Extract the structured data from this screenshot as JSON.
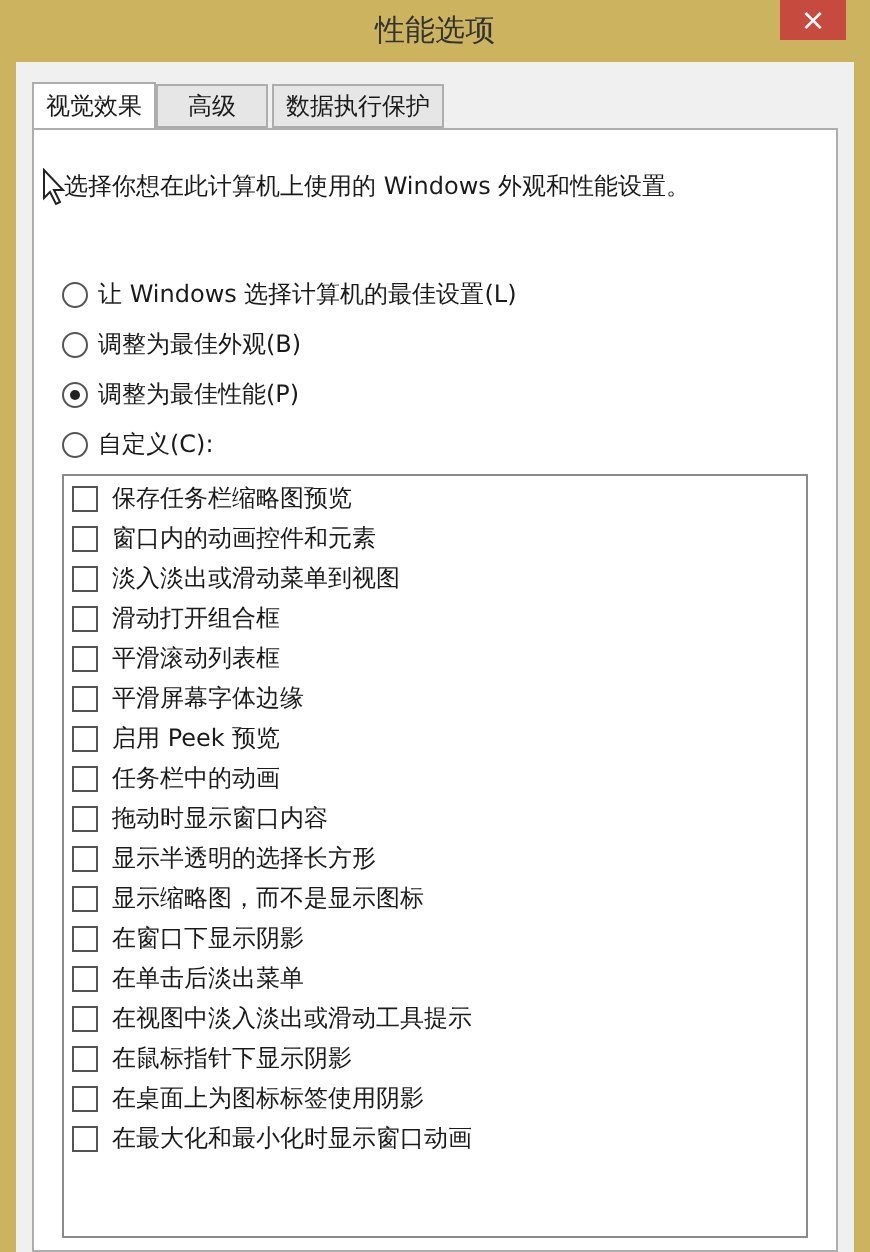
{
  "window": {
    "title": "性能选项",
    "close": "×"
  },
  "tabs": [
    {
      "label": "视觉效果",
      "selected": true
    },
    {
      "label": "高级",
      "selected": false
    },
    {
      "label": "数据执行保护",
      "selected": false
    }
  ],
  "intro": "选择你想在此计算机上使用的 Windows 外观和性能设置。",
  "options": [
    {
      "label": "让 Windows 选择计算机的最佳设置(L)",
      "selected": false
    },
    {
      "label": "调整为最佳外观(B)",
      "selected": false
    },
    {
      "label": "调整为最佳性能(P)",
      "selected": true
    },
    {
      "label": "自定义(C):",
      "selected": false
    }
  ],
  "effects": [
    {
      "label": "保存任务栏缩略图预览",
      "checked": false
    },
    {
      "label": "窗口内的动画控件和元素",
      "checked": false
    },
    {
      "label": "淡入淡出或滑动菜单到视图",
      "checked": false
    },
    {
      "label": "滑动打开组合框",
      "checked": false
    },
    {
      "label": "平滑滚动列表框",
      "checked": false
    },
    {
      "label": "平滑屏幕字体边缘",
      "checked": false
    },
    {
      "label": "启用 Peek 预览",
      "checked": false
    },
    {
      "label": "任务栏中的动画",
      "checked": false
    },
    {
      "label": "拖动时显示窗口内容",
      "checked": false
    },
    {
      "label": "显示半透明的选择长方形",
      "checked": false
    },
    {
      "label": "显示缩略图，而不是显示图标",
      "checked": false
    },
    {
      "label": "在窗口下显示阴影",
      "checked": false
    },
    {
      "label": "在单击后淡出菜单",
      "checked": false
    },
    {
      "label": "在视图中淡入淡出或滑动工具提示",
      "checked": false
    },
    {
      "label": "在鼠标指针下显示阴影",
      "checked": false
    },
    {
      "label": "在桌面上为图标标签使用阴影",
      "checked": false
    },
    {
      "label": "在最大化和最小化时显示窗口动画",
      "checked": false
    }
  ]
}
